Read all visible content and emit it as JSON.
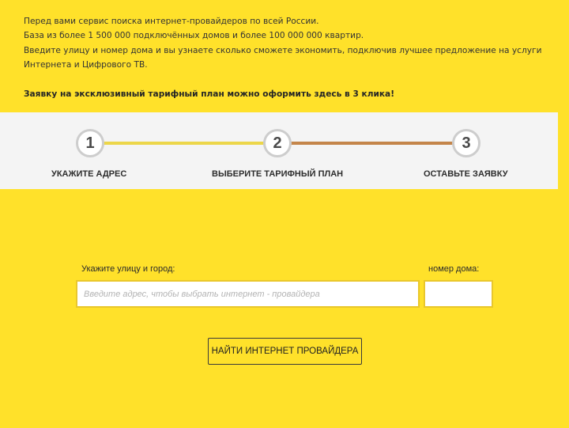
{
  "intro": {
    "line1": "Перед вами сервис поиска интернет-провайдеров по всей России.",
    "line2": "База из более 1 500 000 подключённых домов и более 100 000 000 квартир.",
    "line3": "Введите улицу и номер дома и вы узнаете сколько сможете экономить, подключив лучшее предложение на услуги Интернета и Цифрового ТВ.",
    "cta": "Заявку на эксклюзивный тарифный план можно оформить здесь в 3 клика!"
  },
  "steps": [
    {
      "number": "1",
      "label": "УКАЖИТЕ АДРЕС"
    },
    {
      "number": "2",
      "label": "ВЫБЕРИТЕ ТАРИФНЫЙ ПЛАН"
    },
    {
      "number": "3",
      "label": "ОСТАВЬТЕ ЗАЯВКУ"
    }
  ],
  "form": {
    "street_label": "Укажите улицу и город:",
    "street_placeholder": "Введите адрес, чтобы выбрать интернет - провайдера",
    "street_value": "",
    "house_label": "номер дома:",
    "house_value": "",
    "submit_label": "НАЙТИ ИНТЕРНЕТ ПРОВАЙДЕРА"
  },
  "colors": {
    "background": "#ffe12a",
    "steps_bar": "#f4f4f4",
    "progress_line_1": "#ecd64a",
    "progress_line_2": "#c4854a"
  }
}
